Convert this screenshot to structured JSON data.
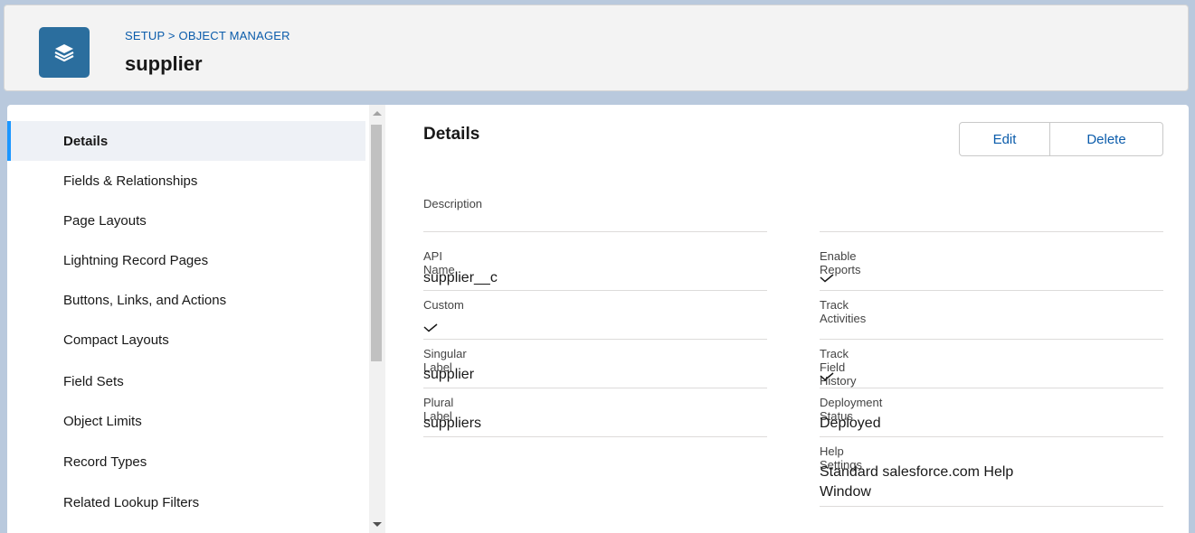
{
  "header": {
    "breadcrumb_setup": "SETUP",
    "breadcrumb_sep": ">",
    "breadcrumb_manager": "OBJECT MANAGER",
    "title": "supplier",
    "icon": "layers-icon"
  },
  "sidebar": {
    "items": [
      {
        "label": "Details"
      },
      {
        "label": "Fields & Relationships"
      },
      {
        "label": "Page Layouts"
      },
      {
        "label": "Lightning Record Pages"
      },
      {
        "label": "Buttons, Links, and Actions"
      },
      {
        "label": "Compact Layouts"
      },
      {
        "label": "Field Sets"
      },
      {
        "label": "Object Limits"
      },
      {
        "label": "Record Types"
      },
      {
        "label": "Related Lookup Filters"
      }
    ]
  },
  "details": {
    "heading": "Details",
    "edit_label": "Edit",
    "delete_label": "Delete",
    "description_label": "Description",
    "api_name_label": "API Name",
    "api_name_value": "supplier__c",
    "custom_label": "Custom",
    "custom_checked": true,
    "singular_label_label": "Singular Label",
    "singular_label_value": "supplier",
    "plural_label_label": "Plural Label",
    "plural_label_value": "suppliers",
    "enable_reports_label": "Enable Reports",
    "enable_reports_checked": true,
    "track_activities_label": "Track Activities",
    "track_activities_checked": false,
    "track_field_history_label": "Track Field History",
    "track_field_history_checked": true,
    "deployment_status_label": "Deployment Status",
    "deployment_status_value": "Deployed",
    "help_settings_label": "Help Settings",
    "help_settings_value_line1": "Standard salesforce.com Help",
    "help_settings_value_line2": "Window"
  },
  "colors": {
    "accent": "#1b96ff",
    "link": "#0b5cab",
    "icon_bg": "#2b6e9e"
  }
}
